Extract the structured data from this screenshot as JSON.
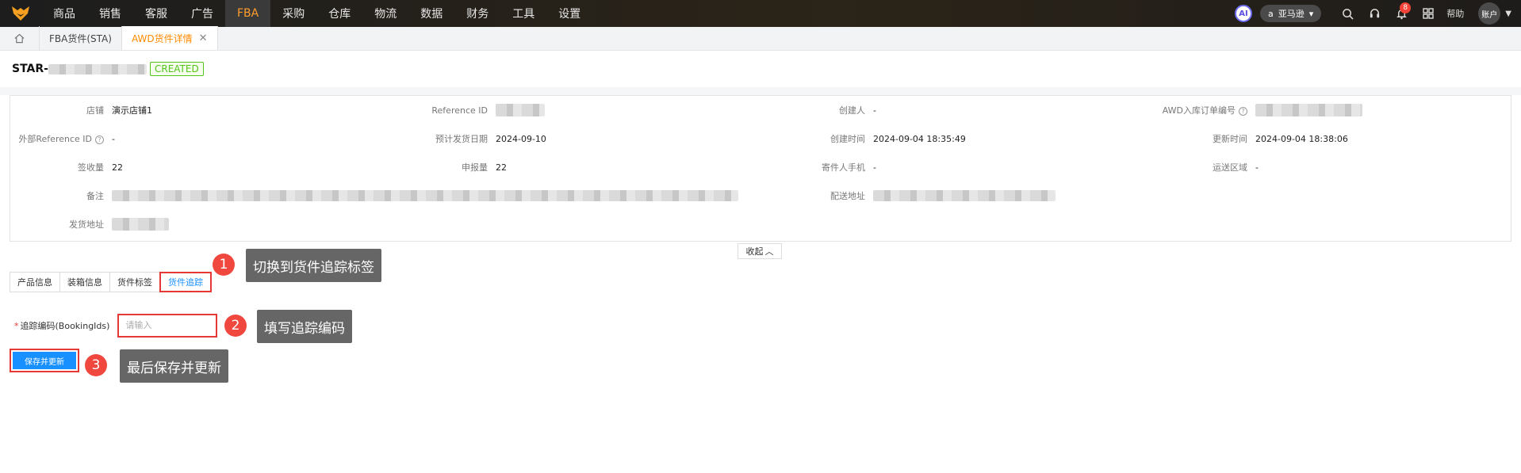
{
  "nav": {
    "items": [
      "商品",
      "销售",
      "客服",
      "广告",
      "FBA",
      "采购",
      "仓库",
      "物流",
      "数据",
      "财务",
      "工具",
      "设置"
    ],
    "active_index": 4,
    "ai_label": "AI",
    "marketplace": "亚马逊",
    "notification_count": "8",
    "help_label": "帮助",
    "account_label": "账户"
  },
  "tabs": {
    "items": [
      {
        "label": "FBA货件(STA)"
      },
      {
        "label": "AWD货件详情"
      }
    ],
    "close_glyph": "✕"
  },
  "header": {
    "shipment_prefix": "STAR-",
    "status": "CREATED"
  },
  "info": {
    "store_label": "店铺",
    "store_value": "演示店铺1",
    "refid_label": "Reference ID",
    "creator_label": "创建人",
    "creator_value": "-",
    "awd_label": "AWD入库订单编号",
    "extref_label": "外部Reference ID",
    "extref_value": "-",
    "planned_label": "预计发货日期",
    "planned_value": "2024-09-10",
    "created_label": "创建时间",
    "created_value": "2024-09-04 18:35:49",
    "updated_label": "更新时间",
    "updated_value": "2024-09-04 18:38:06",
    "received_label": "签收量",
    "received_value": "22",
    "declared_label": "申报量",
    "declared_value": "22",
    "phone_label": "寄件人手机",
    "phone_value": "-",
    "region_label": "运送区域",
    "region_value": "-",
    "remark_label": "备注",
    "ship_to_label": "配送地址",
    "ship_from_label": "发货地址"
  },
  "collapse_label": "收起",
  "subtabs": [
    "产品信息",
    "装箱信息",
    "货件标签",
    "货件追踪"
  ],
  "subtab_active_index": 3,
  "form": {
    "required_mark": "*",
    "tracking_label": "追踪编码(BookingIds)",
    "tracking_placeholder": "请输入",
    "save_label": "保存并更新"
  },
  "annotations": [
    {
      "number": "1",
      "text": "切换到货件追踪标签"
    },
    {
      "number": "2",
      "text": "填写追踪编码"
    },
    {
      "number": "3",
      "text": "最后保存并更新"
    }
  ]
}
